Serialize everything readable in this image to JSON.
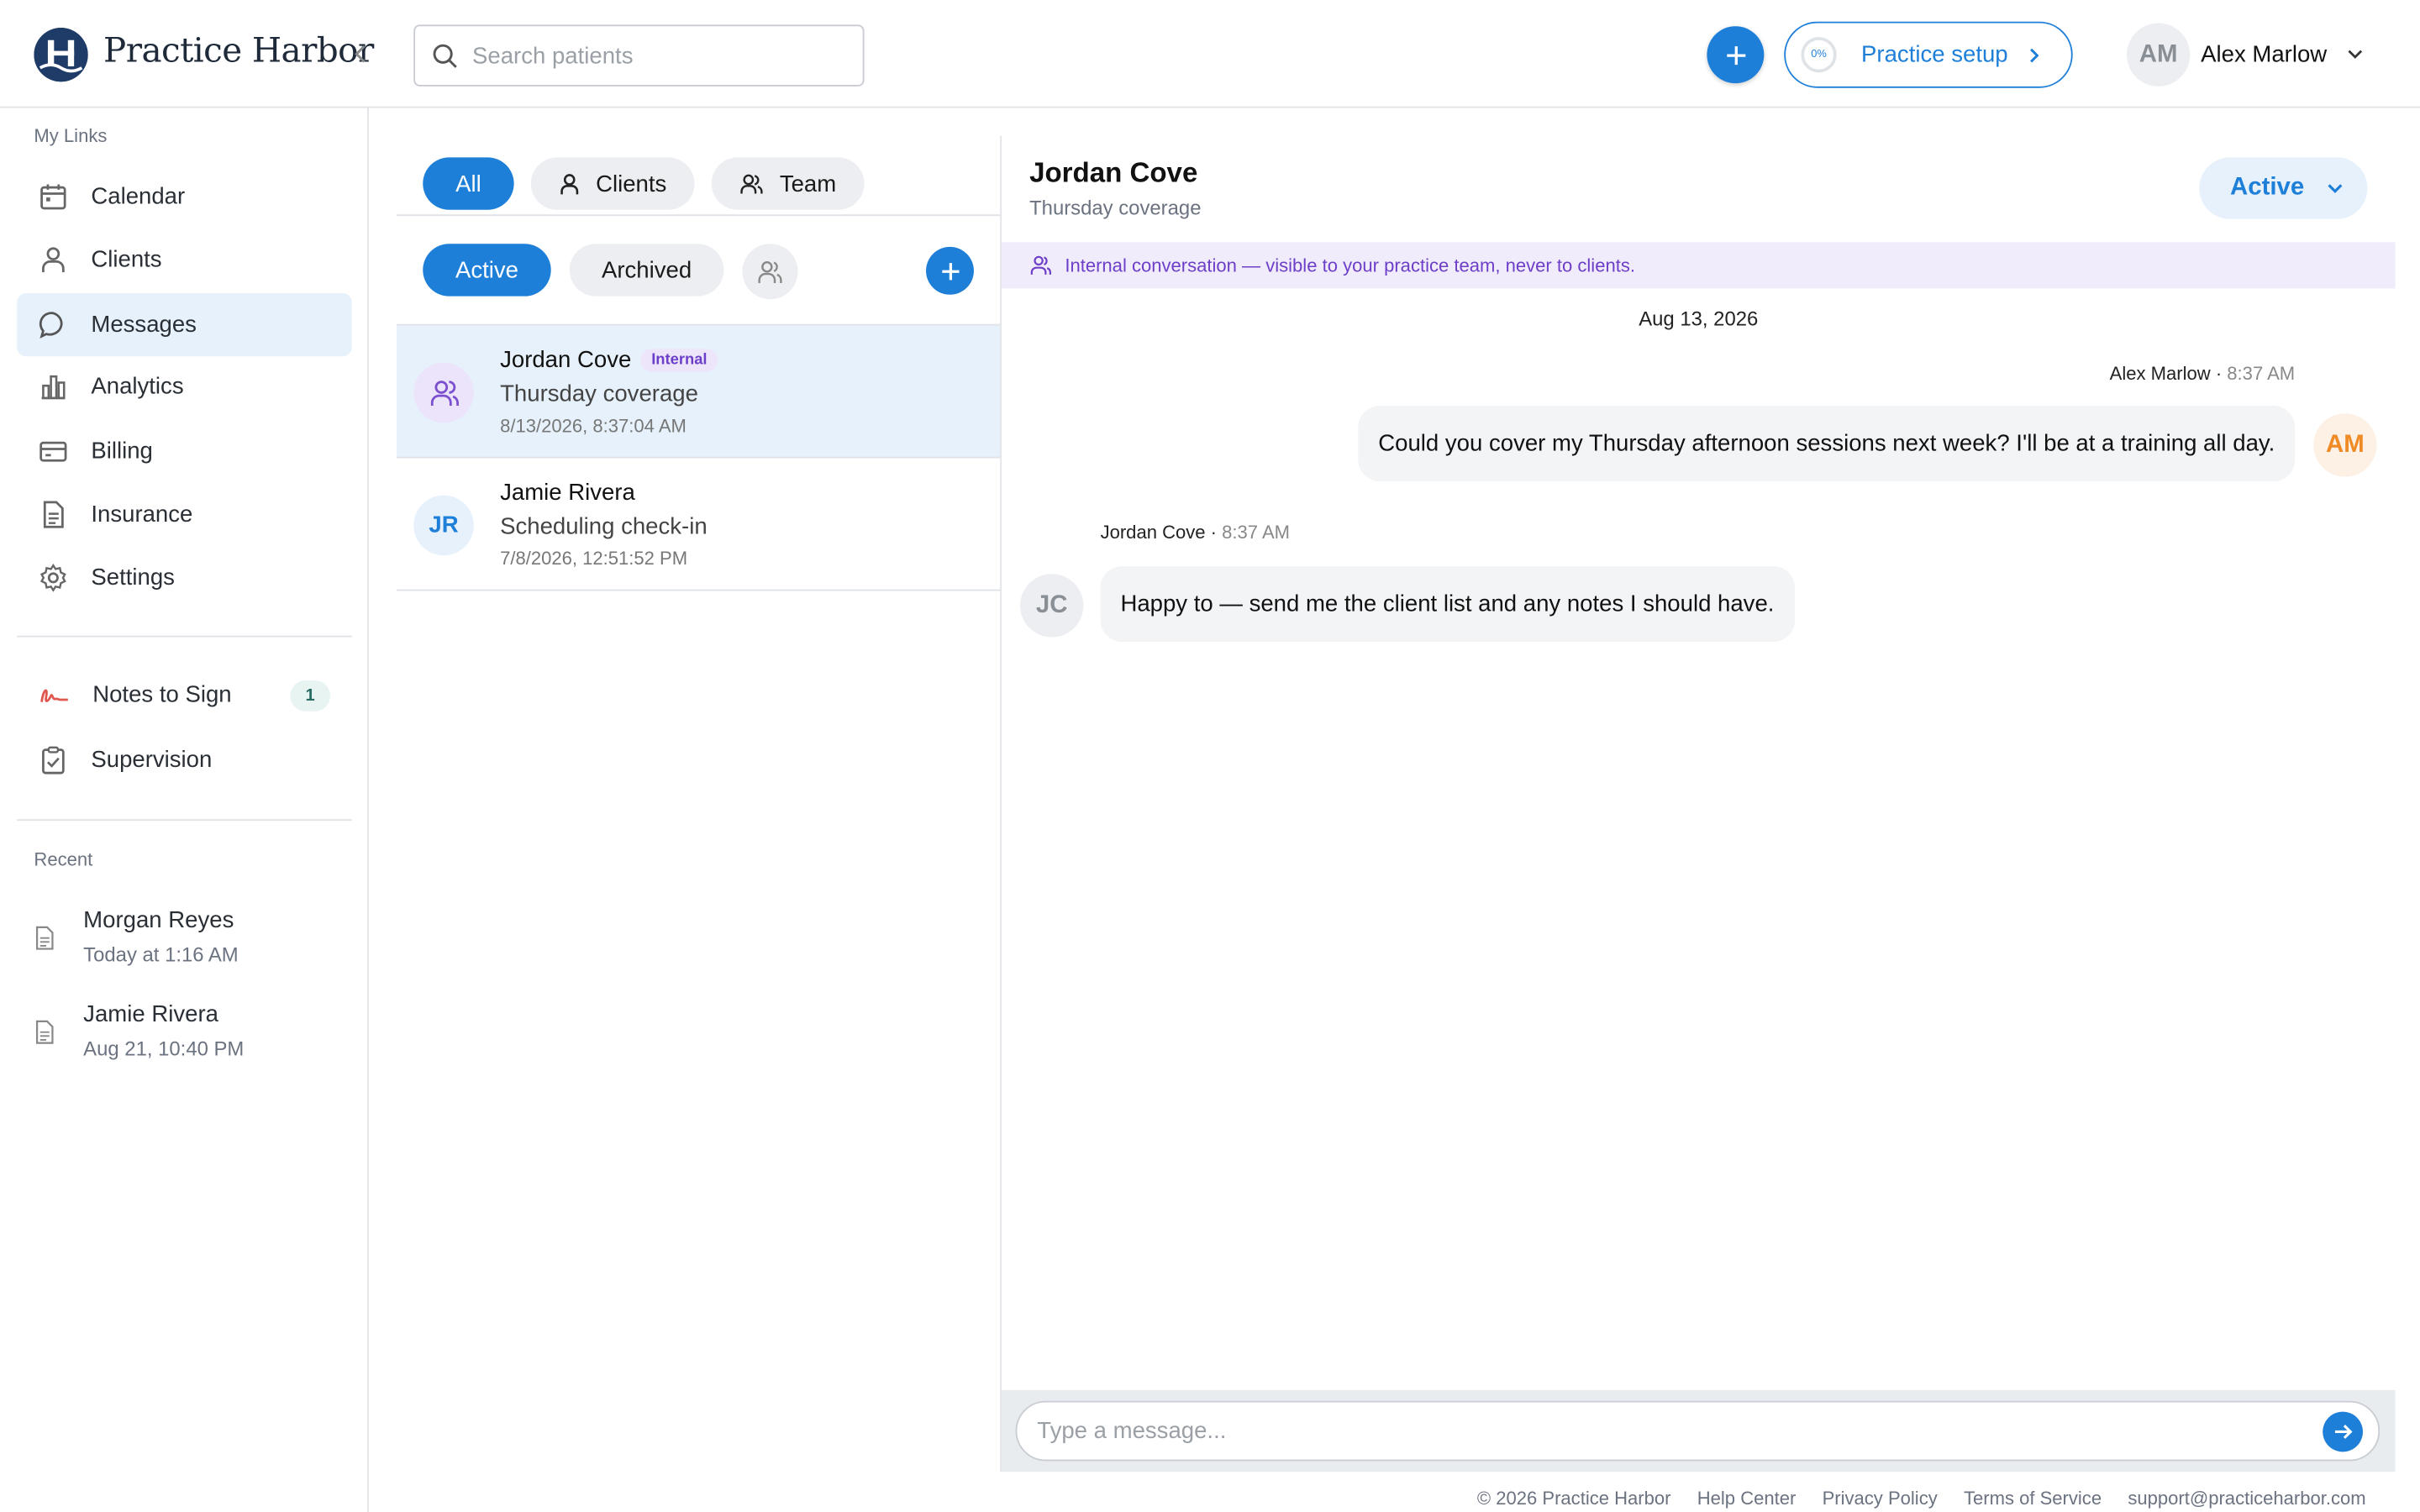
{
  "app": {
    "name": "Practice Harbor"
  },
  "colors": {
    "accent": "#1e7fd9",
    "internal": "#6d3fc8",
    "selected_bg": "#e6f1fb",
    "brand_logo": "#1f3c68"
  },
  "header": {
    "search_placeholder": "Search patients",
    "setup_progress": "0%",
    "setup_label": "Practice setup",
    "user_initials": "AM",
    "user_name": "Alex Marlow"
  },
  "sidebar": {
    "my_links_label": "My Links",
    "items": [
      {
        "label": "Calendar",
        "icon": "calendar-icon"
      },
      {
        "label": "Clients",
        "icon": "person-icon"
      },
      {
        "label": "Messages",
        "icon": "chat-bubble-icon",
        "active": true
      },
      {
        "label": "Analytics",
        "icon": "bar-chart-icon"
      },
      {
        "label": "Billing",
        "icon": "credit-card-icon"
      },
      {
        "label": "Insurance",
        "icon": "document-icon"
      },
      {
        "label": "Settings",
        "icon": "gear-icon"
      }
    ],
    "secondary": [
      {
        "label": "Notes to Sign",
        "icon": "signature-icon",
        "badge": "1"
      },
      {
        "label": "Supervision",
        "icon": "clipboard-check-icon"
      }
    ],
    "recent_label": "Recent",
    "recent": [
      {
        "name": "Morgan Reyes",
        "time": "Today at 1:16 AM"
      },
      {
        "name": "Jamie Rivera",
        "time": "Aug 21, 10:40 PM"
      }
    ]
  },
  "list": {
    "type_tabs": [
      "All",
      "Clients",
      "Team"
    ],
    "status_tabs": [
      "Active",
      "Archived"
    ],
    "conversations": [
      {
        "name": "Jordan Cove",
        "tag": "Internal",
        "subject": "Thursday coverage",
        "time": "8/13/2026, 8:37:04 AM",
        "selected": true
      },
      {
        "name": "Jamie Rivera",
        "initials": "JR",
        "subject": "Scheduling check-in",
        "time": "7/8/2026, 12:51:52 PM"
      }
    ]
  },
  "chat": {
    "name": "Jordan Cove",
    "subject": "Thursday coverage",
    "status": "Active",
    "banner": "Internal conversation — visible to your practice team, never to clients.",
    "date": "Aug 13, 2026",
    "messages": [
      {
        "sender": "Alex Marlow",
        "time": "8:37 AM",
        "text": "Could you cover my Thursday afternoon sessions next week? I'll be at a training all day.",
        "initials": "AM"
      },
      {
        "sender": "Jordan Cove",
        "time": "8:37 AM",
        "text": "Happy to — send me the client list and any notes I should have.",
        "initials": "JC"
      }
    ],
    "composer_placeholder": "Type a message..."
  },
  "footer": {
    "copyright": "© 2026 Practice Harbor",
    "links": [
      "Help Center",
      "Privacy Policy",
      "Terms of Service"
    ],
    "email": "support@practiceharbor.com"
  }
}
